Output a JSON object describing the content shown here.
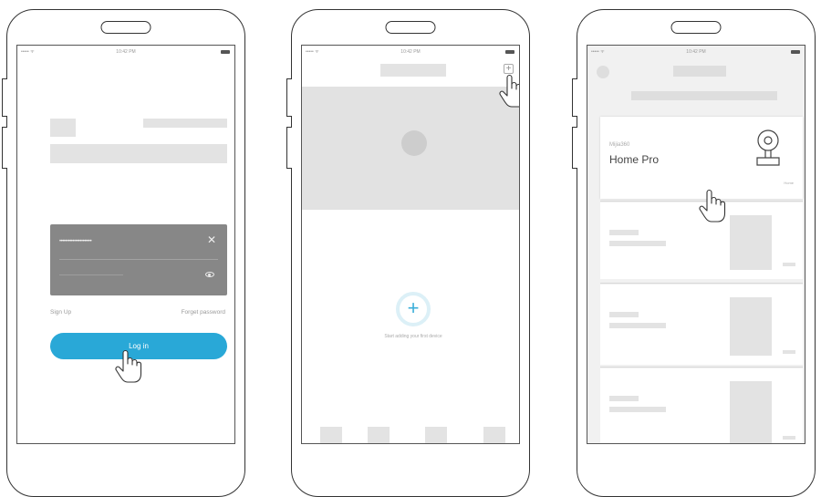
{
  "status_bar": {
    "signal": "•••••  ᯤ",
    "time": "10:42 PM"
  },
  "login": {
    "password_mask": "••••••••••••••••••••••",
    "clear_symbol": "✕",
    "sign_up": "Sign Up",
    "forgot_password": "Forget password",
    "login_button": "Log in"
  },
  "devices_empty": {
    "add_symbol": "+",
    "caption": "Start adding your first device"
  },
  "device_list": {
    "featured": {
      "subtitle": "Mijia360",
      "name": "Home Pro",
      "tiny": "Home"
    }
  },
  "colors": {
    "accent": "#29a8d7",
    "placeholder": "#e3e3e3",
    "panel": "#878787",
    "outline": "#333333"
  },
  "icons": [
    "hand-pointer-icon",
    "camera-icon",
    "eye-icon",
    "plus-icon",
    "close-icon",
    "battery-icon"
  ]
}
